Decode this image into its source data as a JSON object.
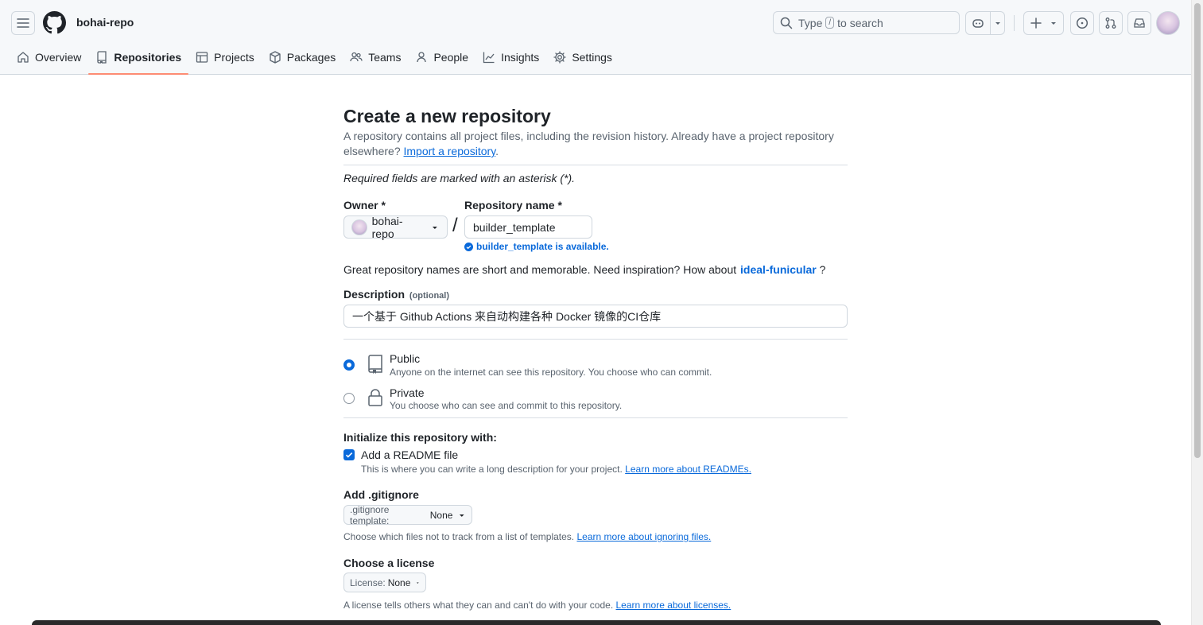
{
  "header": {
    "org_name": "bohai-repo",
    "search": {
      "prefix": "Type",
      "key": "/",
      "suffix": "to search"
    }
  },
  "nav": {
    "items": [
      {
        "label": "Overview",
        "icon": "home-icon"
      },
      {
        "label": "Repositories",
        "icon": "repo-icon",
        "active": true
      },
      {
        "label": "Projects",
        "icon": "table-icon"
      },
      {
        "label": "Packages",
        "icon": "package-icon"
      },
      {
        "label": "Teams",
        "icon": "people-icon"
      },
      {
        "label": "People",
        "icon": "person-icon"
      },
      {
        "label": "Insights",
        "icon": "graph-icon"
      },
      {
        "label": "Settings",
        "icon": "gear-icon"
      }
    ]
  },
  "form": {
    "title": "Create a new repository",
    "intro": "A repository contains all project files, including the revision history. Already have a project repository elsewhere?",
    "import_link": "Import a repository",
    "intro_end": ".",
    "required_note": "Required fields are marked with an asterisk (*).",
    "owner_label": "Owner *",
    "owner_value": "bohai-repo",
    "slash": "/",
    "repo_name_label": "Repository name *",
    "repo_name_value": "builder_template",
    "availability": "builder_template is available.",
    "suggestion_prefix": "Great repository names are short and memorable. Need inspiration? How about",
    "suggestion_name": "ideal-funicular",
    "suggestion_suffix": "?",
    "description_label": "Description",
    "description_optional": "(optional)",
    "description_value": "一个基于 Github Actions 来自动构建各种 Docker 镜像的CI仓库",
    "visibility": {
      "public_label": "Public",
      "public_desc": "Anyone on the internet can see this repository. You choose who can commit.",
      "private_label": "Private",
      "private_desc": "You choose who can see and commit to this repository.",
      "selected": "public"
    },
    "init_label": "Initialize this repository with:",
    "readme_label": "Add a README file",
    "readme_checked": true,
    "readme_desc": "This is where you can write a long description for your project.",
    "readme_link": "Learn more about READMEs.",
    "gitignore_label": "Add .gitignore",
    "gitignore_prefix": ".gitignore template:",
    "gitignore_value": "None",
    "gitignore_desc": "Choose which files not to track from a list of templates.",
    "gitignore_link": "Learn more about ignoring files.",
    "license_label": "Choose a license",
    "license_prefix": "License:",
    "license_value": "None",
    "license_desc": "A license tells others what they can and can't do with your code.",
    "license_link": "Learn more about licenses."
  }
}
